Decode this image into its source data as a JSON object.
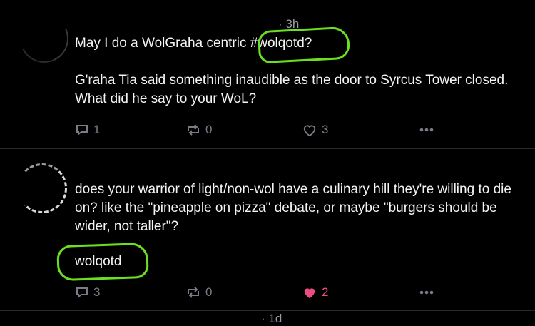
{
  "posts": [
    {
      "time": "· 3h",
      "line1": "May I do a WolGraha centric ",
      "hashtag": "#wolqotd?",
      "body": "G'raha Tia said something inaudible as the door to Syrcus Tower closed. What did he say to your WoL?",
      "replies": "1",
      "reposts": "0",
      "likes": "3"
    },
    {
      "time": "· 1d",
      "body": "does your warrior of light/non-wol have a culinary hill they're willing to die on? like the \"pineapple on pizza\" debate, or maybe \"burgers should be wider, not taller\"?",
      "tag": "wolqotd",
      "replies": "3",
      "reposts": "0",
      "likes": "2"
    }
  ],
  "colors": {
    "highlight": "#6be021",
    "liked": "#ec4d80",
    "muted": "#7c7c88"
  },
  "icons": [
    "reply-icon",
    "repost-icon",
    "heart-icon",
    "more-icon"
  ]
}
